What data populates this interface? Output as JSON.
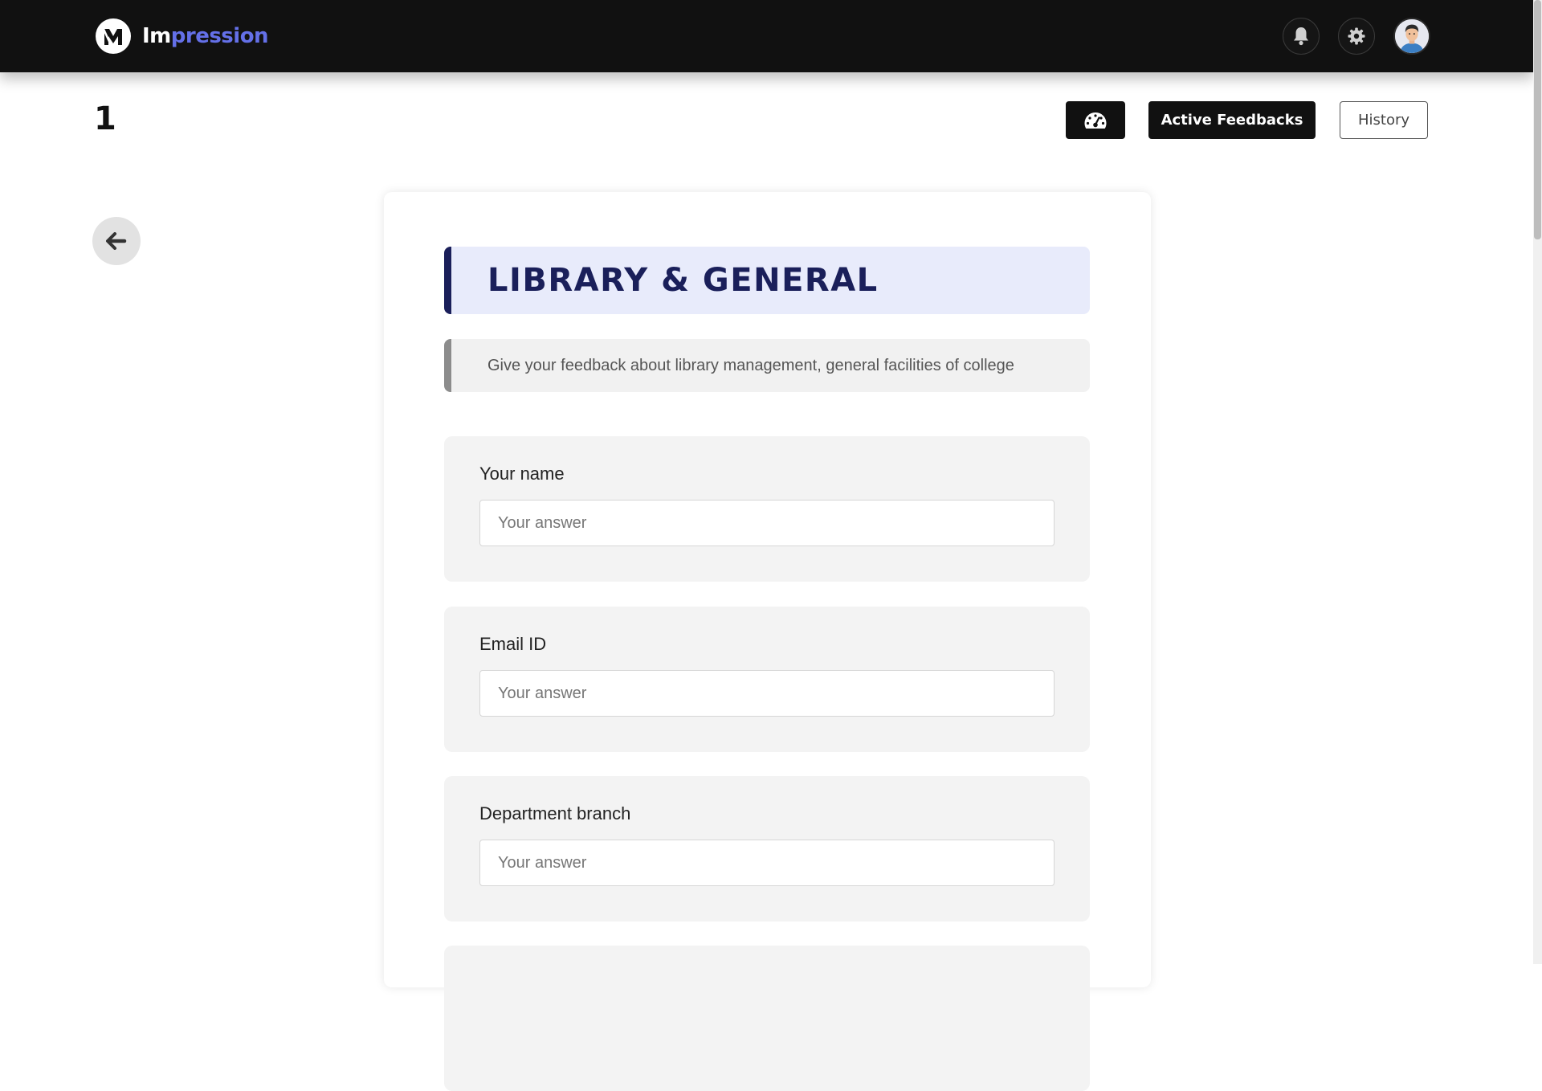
{
  "app": {
    "brand_part1": "Im",
    "brand_part2": "pression",
    "accent_color": "#6470e8"
  },
  "navbar": {
    "icons": [
      "bell-icon",
      "gear-icon",
      "avatar"
    ]
  },
  "toolbar": {
    "page_number": "1",
    "dashboard_icon": "speedometer-icon",
    "active_feedbacks_label": "Active Feedbacks",
    "history_label": "History"
  },
  "form": {
    "title": "LIBRARY & GENERAL",
    "description": "Give your feedback about library management, general facilities of college",
    "questions": [
      {
        "label": "Your name",
        "placeholder": "Your answer",
        "value": ""
      },
      {
        "label": "Email ID",
        "placeholder": "Your answer",
        "value": ""
      },
      {
        "label": "Department branch",
        "placeholder": "Your answer",
        "value": ""
      }
    ]
  }
}
